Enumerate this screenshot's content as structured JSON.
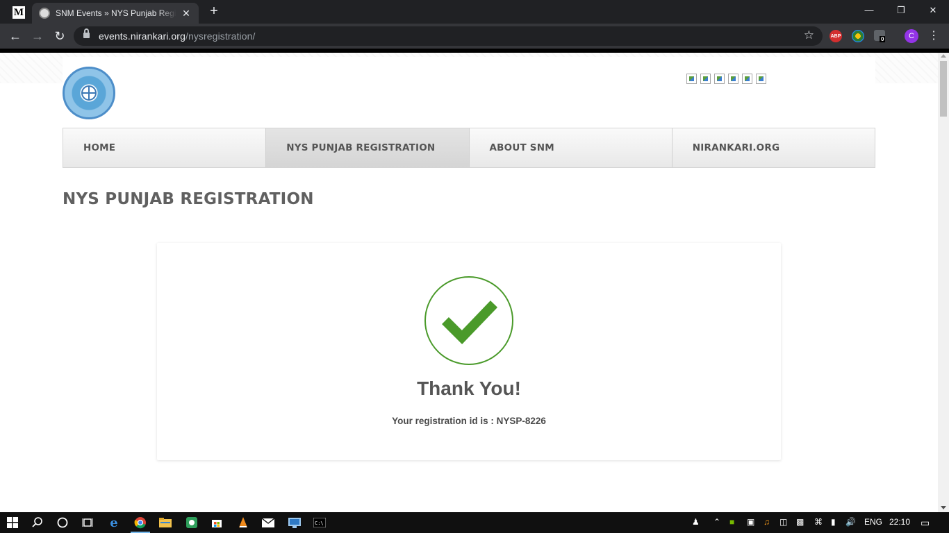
{
  "browser": {
    "pinned_tab_letter": "M",
    "tab_title": "SNM Events » NYS Punjab Registration",
    "tab_close": "✕",
    "new_tab": "+",
    "window_controls": {
      "minimize": "—",
      "restore": "❐",
      "close": "✕"
    },
    "url_host": "events.nirankari.org",
    "url_path": "/nysregistration/",
    "extensions": [
      {
        "name": "adblock-plus",
        "label": "ABP",
        "color": "#d32f2f"
      },
      {
        "name": "extension-globe",
        "label": "",
        "color": "#2e7d32"
      },
      {
        "name": "extension-counter",
        "label": "0",
        "color": "#5f6368"
      }
    ],
    "profile_initial": "C"
  },
  "site": {
    "nav": [
      {
        "label": "HOME",
        "active": false
      },
      {
        "label": "NYS PUNJAB REGISTRATION",
        "active": true
      },
      {
        "label": "ABOUT SNM",
        "active": false
      },
      {
        "label": "NIRANKARI.ORG",
        "active": false
      }
    ],
    "social_icons": [
      "social-icon",
      "social-icon",
      "social-icon",
      "social-icon",
      "social-icon",
      "social-icon"
    ],
    "page_title": "NYS PUNJAB REGISTRATION"
  },
  "confirmation": {
    "heading": "Thank You!",
    "message": "Your registration id is : NYSP-8226",
    "accent_color": "#4a9a2a"
  },
  "taskbar": {
    "language": "ENG",
    "time": "22:10"
  }
}
